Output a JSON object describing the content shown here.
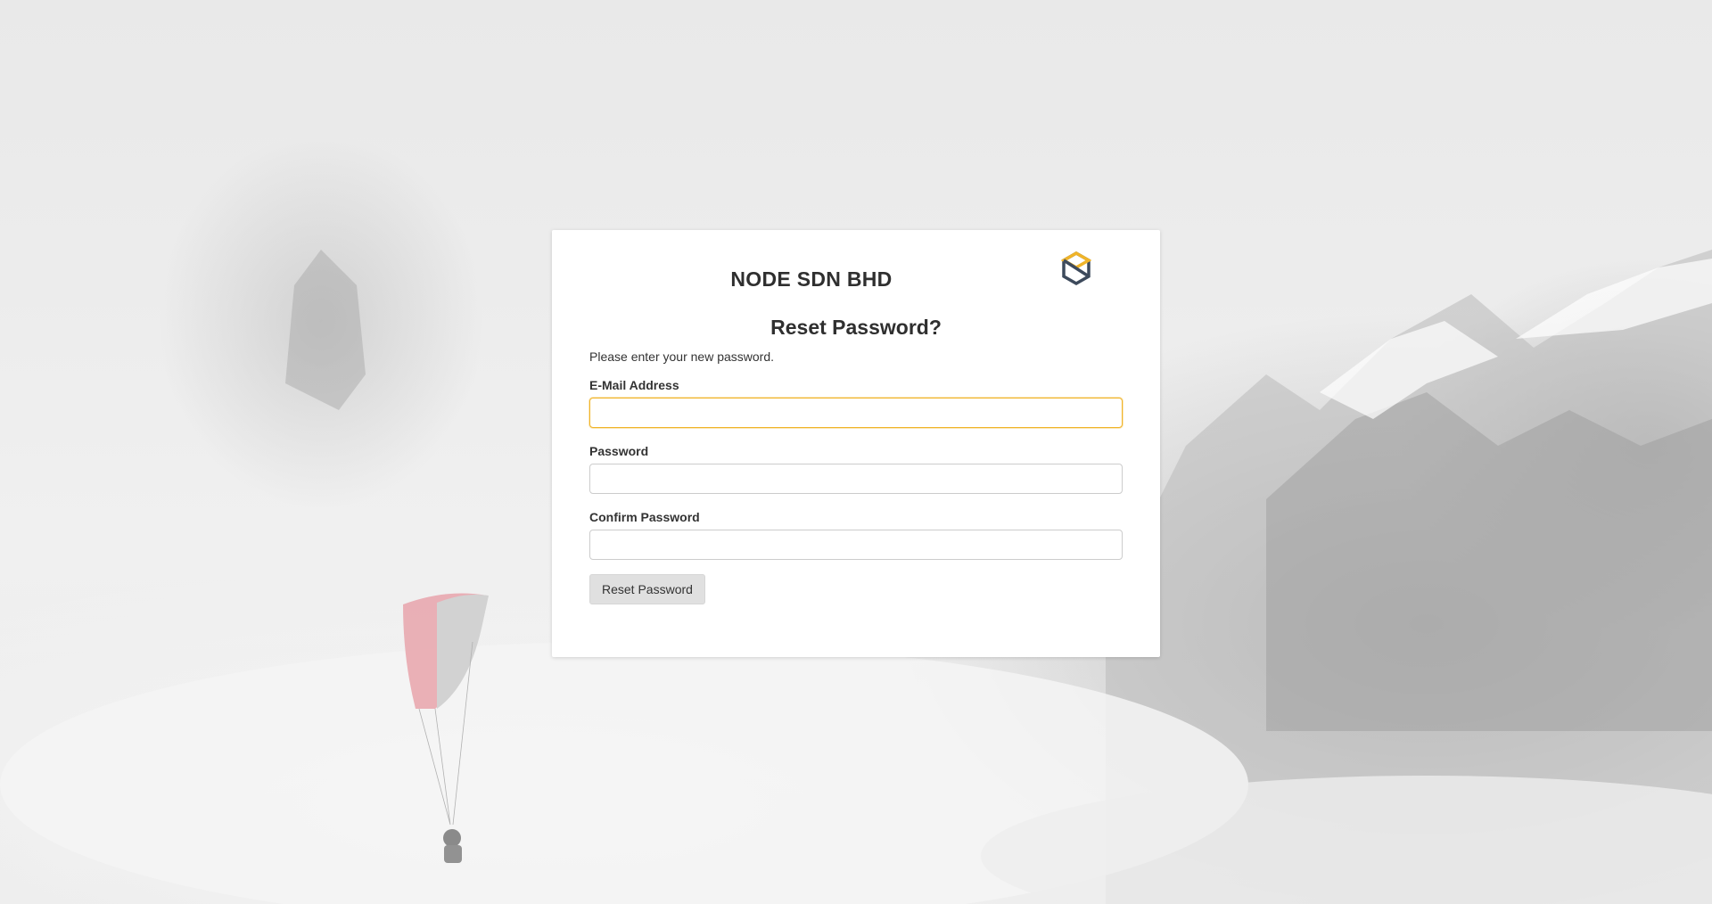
{
  "app": {
    "brand_name": "NODE SDN BHD",
    "logo_icon": "hexagon-s-logo",
    "accent_color": "#f0b429",
    "logo_dark_color": "#3d4a5c"
  },
  "form": {
    "title": "Reset Password?",
    "instructions": "Please enter your new password.",
    "email_label": "E-Mail Address",
    "email_value": "",
    "password_label": "Password",
    "password_value": "",
    "confirm_label": "Confirm Password",
    "confirm_value": "",
    "submit_label": "Reset Password"
  }
}
